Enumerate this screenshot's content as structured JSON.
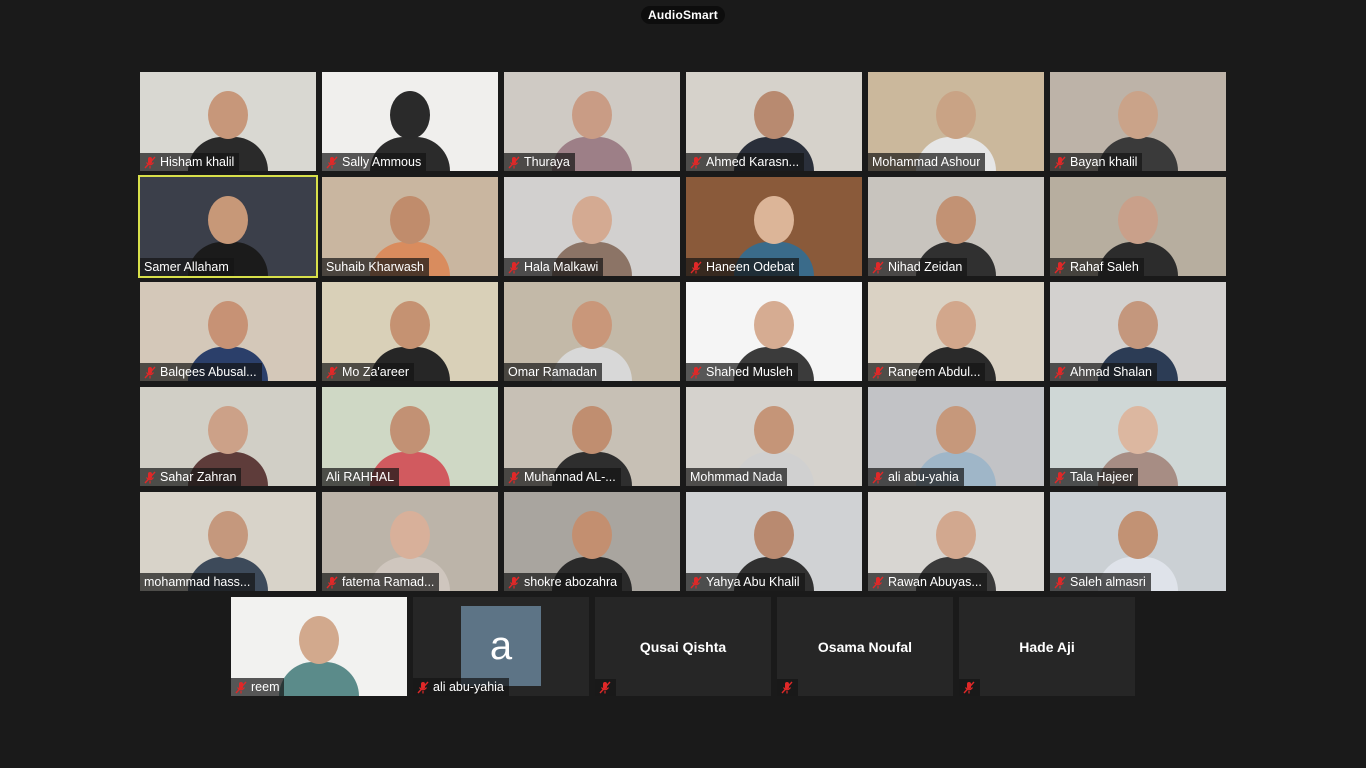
{
  "app": {
    "title": "AudioSmart"
  },
  "colors": {
    "active_speaker": "#d8e04a",
    "muted_icon": "#e02828",
    "tile_bg": "#262626"
  },
  "grid": [
    {
      "name": "Hisham khalil",
      "muted": true,
      "bg": "#d9d8d2",
      "skin": "#c7977a",
      "shirt": "#2a2a2a"
    },
    {
      "name": "Sally Ammous",
      "muted": true,
      "bg": "#f0efed",
      "skin": "#2a2a2a",
      "shirt": "#2b2b2b"
    },
    {
      "name": "Thuraya",
      "muted": true,
      "bg": "#cfcac4",
      "skin": "#c99c85",
      "shirt": "#9d7f87"
    },
    {
      "name": "Ahmed Karasn...",
      "muted": true,
      "bg": "#d6d2cb",
      "skin": "#b88a70",
      "shirt": "#2a2f3a"
    },
    {
      "name": "Mohammad Ashour",
      "muted": false,
      "bg": "#cbb89c",
      "skin": "#c9a385",
      "shirt": "#e6e6e6"
    },
    {
      "name": "Bayan khalil",
      "muted": true,
      "bg": "#bdb3a8",
      "skin": "#caa389",
      "shirt": "#3a3a3a"
    },
    {
      "name": "Samer Allaham",
      "muted": false,
      "active": true,
      "bg": "#3b3f4a",
      "skin": "#c79878",
      "shirt": "#1b1b1b"
    },
    {
      "name": "Suhaib Kharwash",
      "muted": false,
      "bg": "#c9b6a0",
      "skin": "#c08c6c",
      "shirt": "#d98c5e"
    },
    {
      "name": "Hala Malkawi",
      "muted": true,
      "bg": "#d2d0cf",
      "skin": "#d4aa92",
      "shirt": "#8c7466"
    },
    {
      "name": "Haneen Odebat",
      "muted": true,
      "bg": "#8a5a3a",
      "skin": "#dcb598",
      "shirt": "#3a6b8a"
    },
    {
      "name": "Nihad Zeidan",
      "muted": true,
      "bg": "#c8c4be",
      "skin": "#c29274",
      "shirt": "#303030"
    },
    {
      "name": "Rahaf Saleh",
      "muted": true,
      "bg": "#b7ae9f",
      "skin": "#c9a08a",
      "shirt": "#2c2c2c"
    },
    {
      "name": "Balqees Abusal...",
      "muted": true,
      "bg": "#d4c8b9",
      "skin": "#c79275",
      "shirt": "#2b3f6a"
    },
    {
      "name": "Mo Za'areer",
      "muted": true,
      "bg": "#d9d0b8",
      "skin": "#c59272",
      "shirt": "#262626"
    },
    {
      "name": "Omar Ramadan",
      "muted": false,
      "bg": "#c3b9a8",
      "skin": "#c9977a",
      "shirt": "#d8d8d8"
    },
    {
      "name": "Shahed Musleh",
      "muted": true,
      "bg": "#f5f5f5",
      "skin": "#d6ac92",
      "shirt": "#3b3b3b"
    },
    {
      "name": "Raneem Abdul...",
      "muted": true,
      "bg": "#dad2c4",
      "skin": "#d2a78c",
      "shirt": "#2a2a2a"
    },
    {
      "name": "Ahmad Shalan",
      "muted": true,
      "bg": "#d3d1cf",
      "skin": "#c4977d",
      "shirt": "#2c3c55"
    },
    {
      "name": "Sahar Zahran",
      "muted": true,
      "bg": "#d1cfc6",
      "skin": "#cca188",
      "shirt": "#5e3c3a"
    },
    {
      "name": "Ali RAHHAL",
      "muted": false,
      "bg": "#cfd8c5",
      "skin": "#c29174",
      "shirt": "#d15a5f"
    },
    {
      "name": "Muhannad AL-...",
      "muted": true,
      "bg": "#c7c0b5",
      "skin": "#c08e70",
      "shirt": "#2e2e2e"
    },
    {
      "name": "Mohmmad Nada",
      "muted": false,
      "bg": "#d5d2cd",
      "skin": "#c59578",
      "shirt": "#d0d0d0"
    },
    {
      "name": "ali abu-yahia",
      "muted": true,
      "bg": "#c2c3c6",
      "skin": "#c6987b",
      "shirt": "#9fb6c8"
    },
    {
      "name": "Tala Hajeer",
      "muted": true,
      "bg": "#cfd7d6",
      "skin": "#dcb7a0",
      "shirt": "#a78d84"
    },
    {
      "name": "mohammad hass...",
      "muted": false,
      "bg": "#d8d3c9",
      "skin": "#c5987d",
      "shirt": "#3d4a5a"
    },
    {
      "name": "fatema Ramad...",
      "muted": true,
      "bg": "#bcb4a9",
      "skin": "#d8b09a",
      "shirt": "#cfc6be"
    },
    {
      "name": "shokre abozahra",
      "muted": true,
      "bg": "#a9a59f",
      "skin": "#c38f70",
      "shirt": "#2a2a2a"
    },
    {
      "name": "Yahya Abu Khalil",
      "muted": true,
      "bg": "#d0d2d4",
      "skin": "#b98a70",
      "shirt": "#303030"
    },
    {
      "name": "Rawan Abuyas...",
      "muted": true,
      "bg": "#d8d6d2",
      "skin": "#d2a88f",
      "shirt": "#3a3a3a"
    },
    {
      "name": "Saleh almasri",
      "muted": true,
      "bg": "#cbd0d4",
      "skin": "#c29274",
      "shirt": "#dfe3ea"
    }
  ],
  "bottom": [
    {
      "type": "video",
      "name": "reem",
      "muted": true,
      "bg": "#f2f2f0",
      "skin": "#d2a98d",
      "shirt": "#5b8b8a"
    },
    {
      "type": "avatar",
      "name": "ali abu-yahia",
      "muted": true,
      "letter": "a"
    },
    {
      "type": "text",
      "display": "Qusai Qishta",
      "muted": true
    },
    {
      "type": "text",
      "display": "Osama Noufal",
      "muted": true
    },
    {
      "type": "text",
      "display": "Hade Aji",
      "muted": true
    }
  ]
}
